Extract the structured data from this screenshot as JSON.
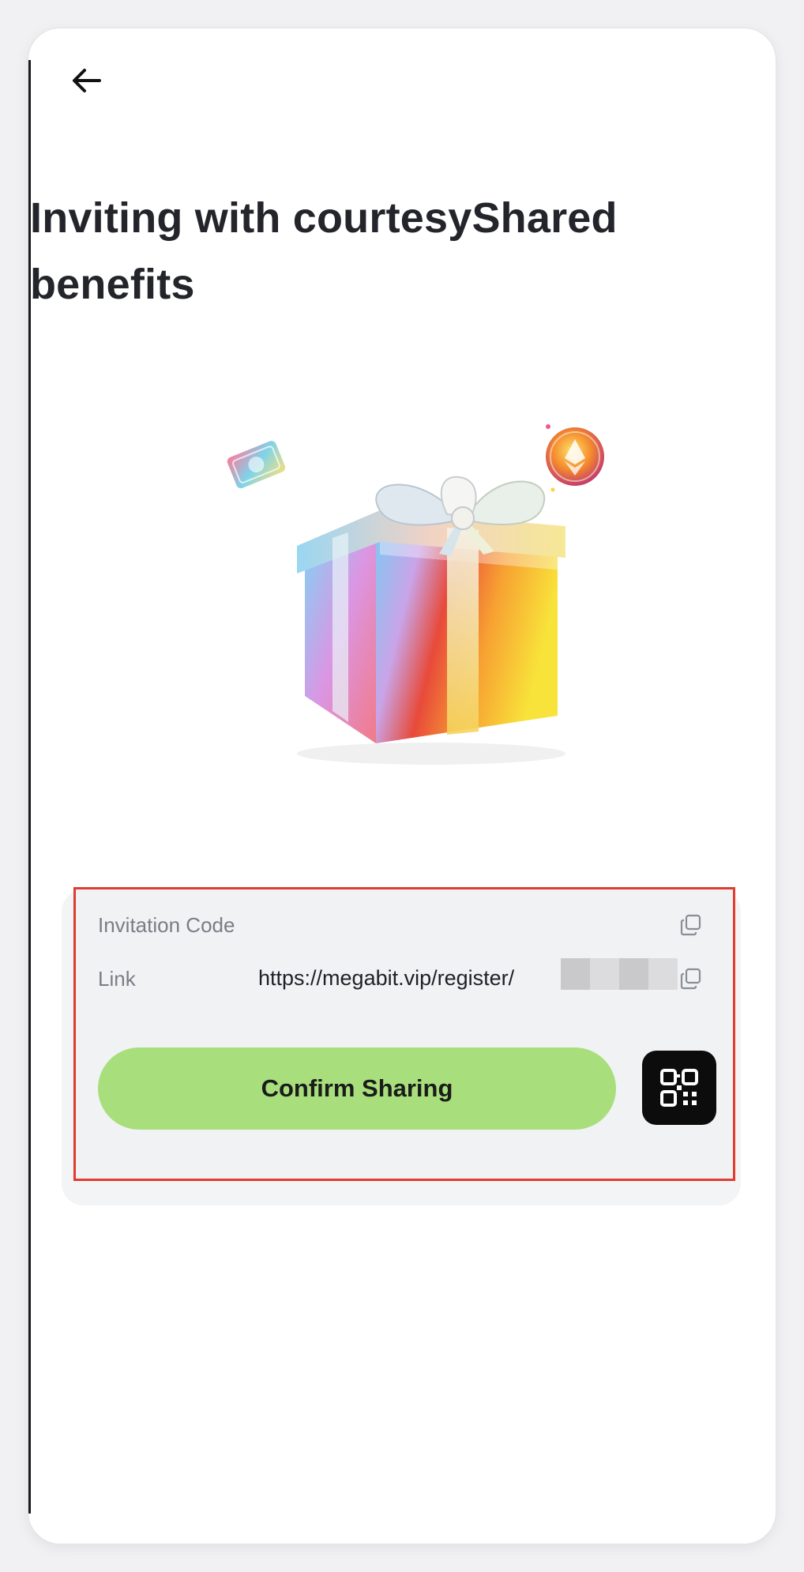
{
  "header": {
    "back_icon": "arrow-left-icon",
    "title": "Inviting with courtesyShared benefits"
  },
  "hero": {
    "image": "rainbow-gift-box-illustration",
    "decorations": [
      "ticket-icon",
      "ethereum-coin-icon"
    ]
  },
  "invite_panel": {
    "code_label": "Invitation Code",
    "code_value": "",
    "link_label": "Link",
    "link_value": "https://megabit.vip/register/",
    "copy_icon": "copy-icon",
    "confirm_label": "Confirm Sharing",
    "qr_icon": "qr-code-icon"
  },
  "colors": {
    "primary_button": "#a8df7c",
    "highlight_border": "#e23b2f",
    "title_text": "#23252b",
    "qr_button": "#0c0c0c"
  }
}
